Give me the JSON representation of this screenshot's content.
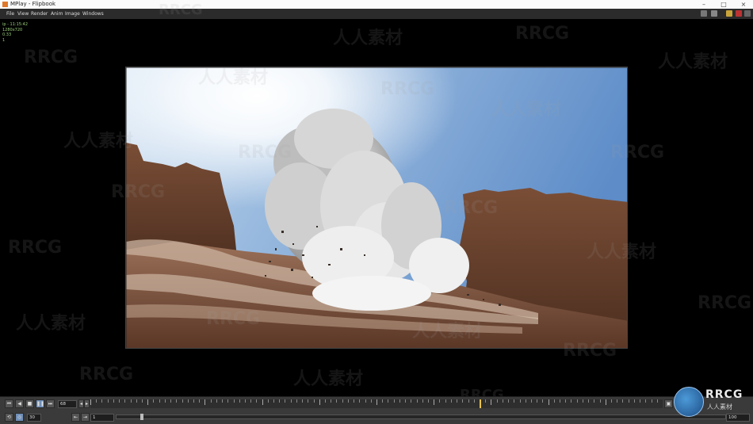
{
  "window": {
    "title": "MPlay - Flipbook"
  },
  "menu": {
    "items": [
      "File",
      "View",
      "Render",
      "Anim",
      "Image",
      "Windows"
    ]
  },
  "viewer": {
    "info_lines": [
      "ip - 11:15:42",
      "1280x720",
      "0.33",
      "1"
    ]
  },
  "playbar": {
    "frame_value": "68",
    "step_value": "30",
    "range_start": "1",
    "range_end": "100",
    "playhead_fraction": 0.68
  },
  "watermarks": {
    "latin": "RRCG",
    "cjk": "人人素材"
  },
  "logo": {
    "title": "RRCG",
    "subtitle": "人人素材"
  },
  "colors": {
    "accent": "#6f8fb8",
    "playhead": "#e8c24a",
    "info_text": "#9acd7a"
  }
}
